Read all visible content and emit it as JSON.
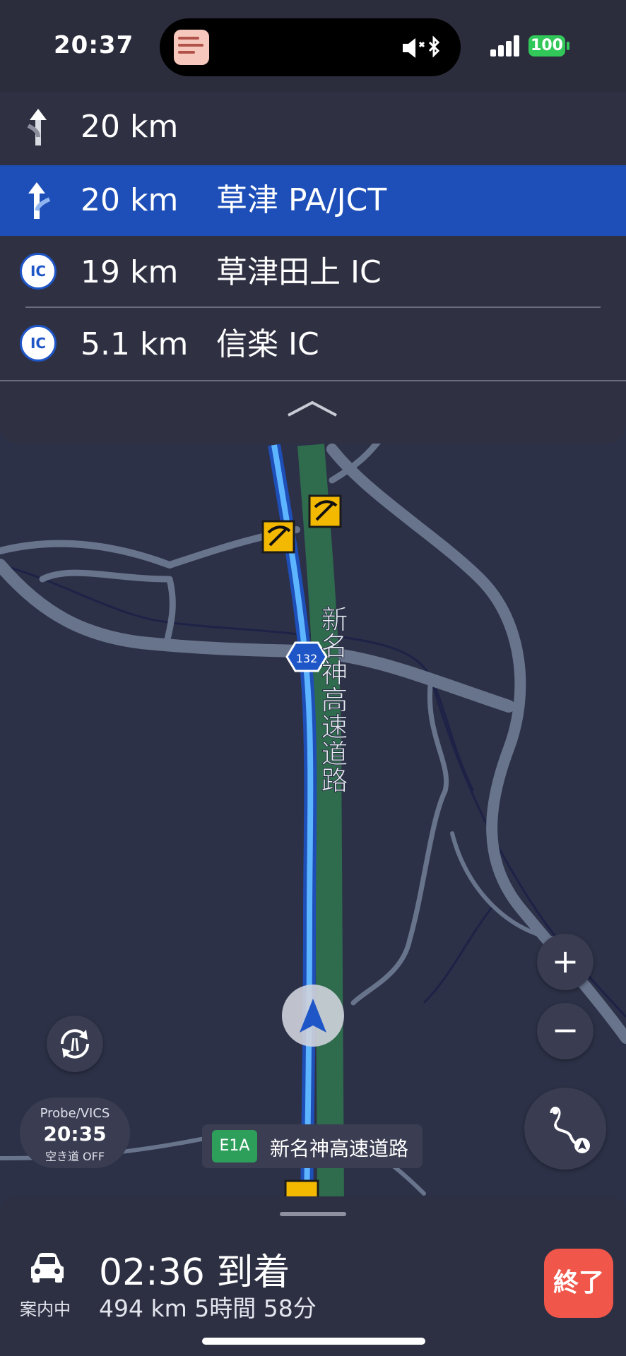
{
  "status_bar": {
    "time": "20:37",
    "battery": "100"
  },
  "guidance": {
    "rows": [
      {
        "distance": "20 km",
        "name": "",
        "icon": "straight-arrow-icon"
      },
      {
        "distance": "20 km",
        "name": "草津 PA/JCT",
        "icon": "fork-right-arrow-icon"
      },
      {
        "distance": "19 km",
        "name": "草津田上 IC",
        "icon": "ic-badge-icon",
        "badge": "IC"
      },
      {
        "distance": "5.1 km",
        "name": "信楽 IC",
        "icon": "ic-badge-icon",
        "badge": "IC"
      }
    ]
  },
  "map": {
    "route_shield": "132",
    "highway_label": "新名神高速道路"
  },
  "probe": {
    "title": "Probe/VICS",
    "time": "20:35",
    "mode": "空き道 OFF"
  },
  "road_label": {
    "code": "E1A",
    "name": "新名神高速道路"
  },
  "zoom": {
    "in_label": "+",
    "out_label": "−"
  },
  "bottom": {
    "status": "案内中",
    "arrival": "02:36 到着",
    "distance_time": "494 km  5時間 58分",
    "end_label": "終了"
  },
  "colors": {
    "route_blue": "#1e90ff",
    "highway_green": "#2f6b4d",
    "active_row": "#1e4fb8",
    "end_button": "#f0564a"
  }
}
